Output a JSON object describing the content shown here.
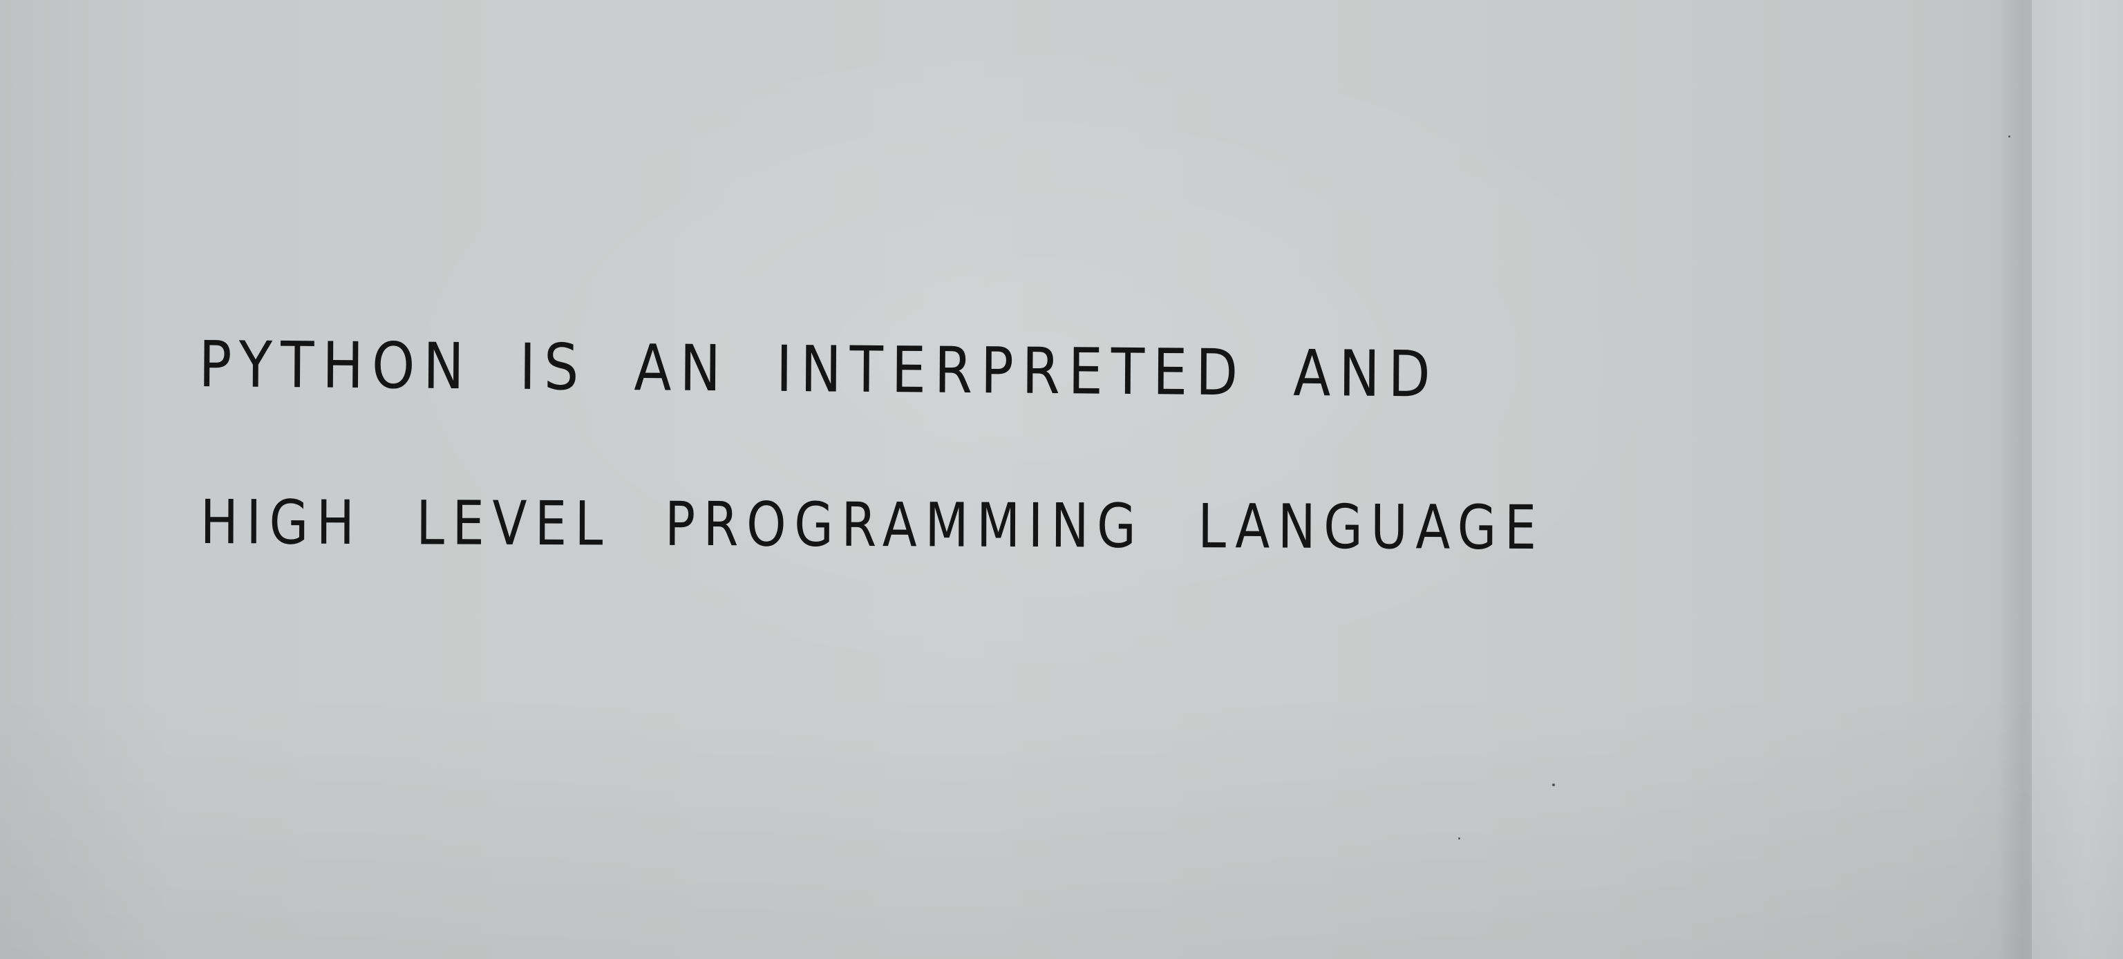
{
  "document": {
    "lines": [
      "PYTHON IS AN INTERPRETED AND",
      "HIGH LEVEL PROGRAMMING LANGUAGE"
    ]
  }
}
